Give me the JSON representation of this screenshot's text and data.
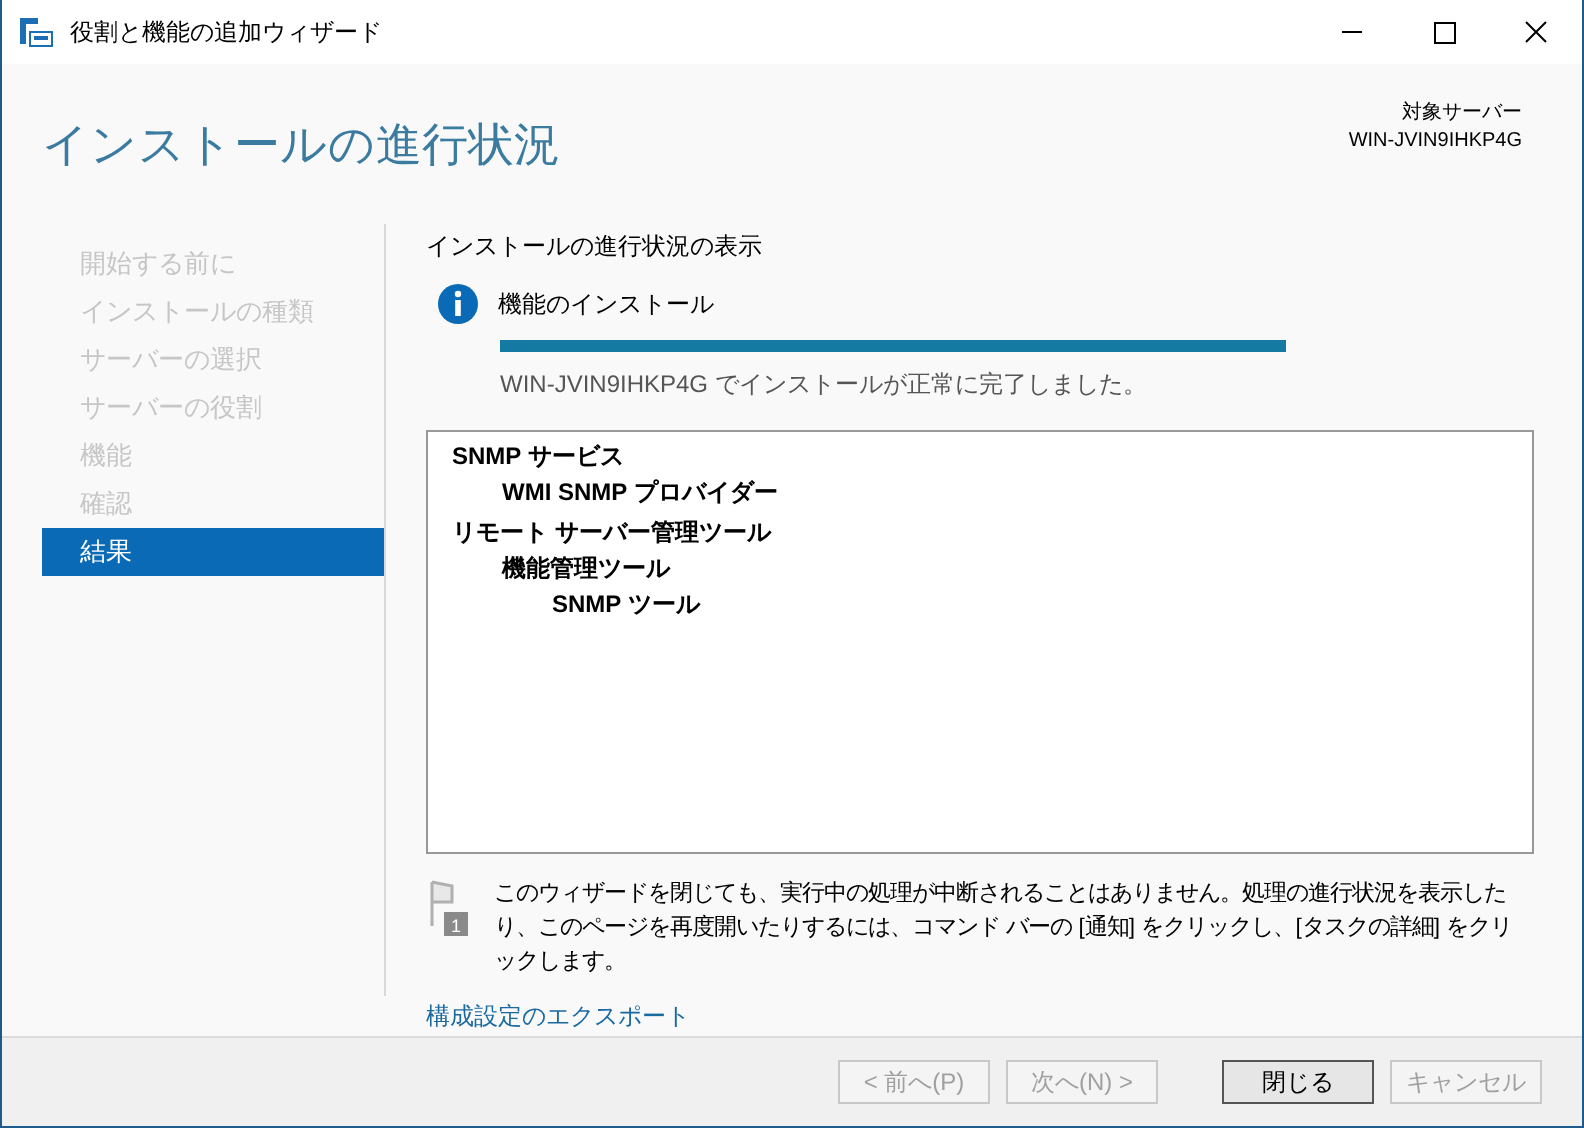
{
  "window": {
    "title": "役割と機能の追加ウィザード"
  },
  "header": {
    "title": "インストールの進行状況",
    "target_label": "対象サーバー",
    "target_server": "WIN-JVIN9IHKP4G"
  },
  "steps": [
    {
      "label": "開始する前に",
      "selected": false
    },
    {
      "label": "インストールの種類",
      "selected": false
    },
    {
      "label": "サーバーの選択",
      "selected": false
    },
    {
      "label": "サーバーの役割",
      "selected": false
    },
    {
      "label": "機能",
      "selected": false
    },
    {
      "label": "確認",
      "selected": false
    },
    {
      "label": "結果",
      "selected": true
    }
  ],
  "content": {
    "heading": "インストールの進行状況の表示",
    "status_title": "機能のインストール",
    "progress": {
      "level": 1.0
    },
    "status_message": "WIN-JVIN9IHKP4G でインストールが正常に完了しました。",
    "results": [
      {
        "label": "SNMP サービス",
        "children": [
          {
            "label": "WMI SNMP プロバイダー"
          }
        ]
      },
      {
        "label": "リモート サーバー管理ツール",
        "children": [
          {
            "label": "機能管理ツール",
            "children": [
              {
                "label": "SNMP ツール"
              }
            ]
          }
        ]
      }
    ],
    "note": "このウィザードを閉じても、実行中の処理が中断されることはありません。処理の進行状況を表示したり、このページを再度開いたりするには、コマンド バーの [通知] をクリックし、[タスクの詳細] をクリックします。",
    "note_badge": "1",
    "export_link": "構成設定のエクスポート"
  },
  "buttons": [
    {
      "label": "< 前へ(P)",
      "disabled": true,
      "default": false
    },
    {
      "label": "次へ(N) >",
      "disabled": true,
      "default": false
    },
    {
      "label": "閉じる",
      "disabled": false,
      "default": true
    },
    {
      "label": "キャンセル",
      "disabled": true,
      "default": false
    }
  ]
}
